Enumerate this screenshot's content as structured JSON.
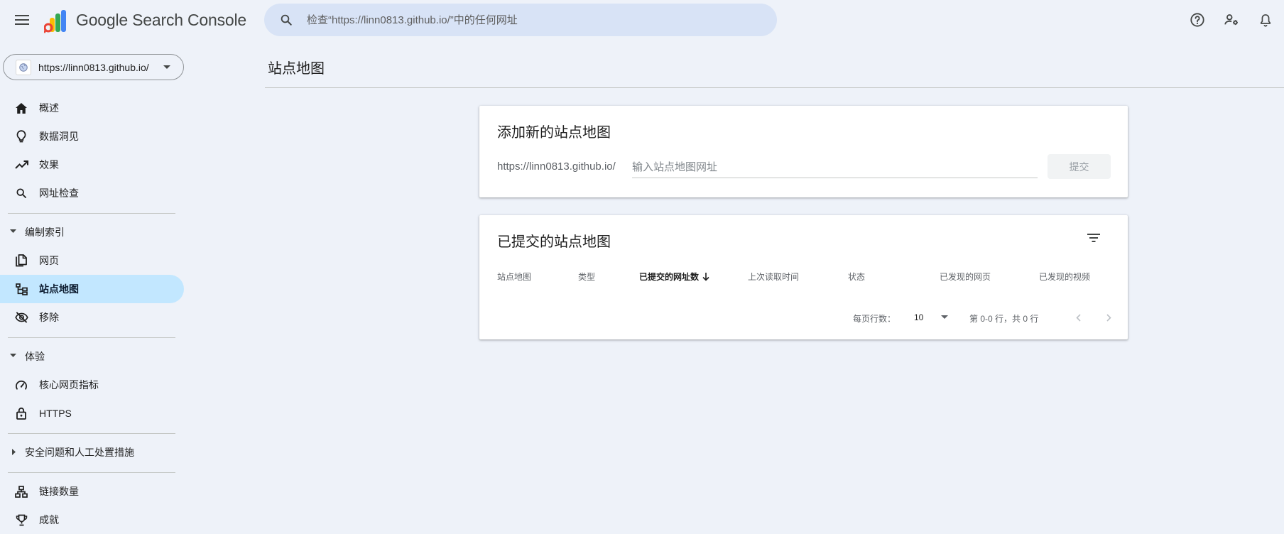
{
  "header": {
    "product_name": "Google Search Console",
    "search_placeholder": "检查“https://linn0813.github.io/”中的任何网址",
    "icons": [
      "menu-icon",
      "search-icon",
      "help-icon",
      "manage-users-icon",
      "notifications-icon"
    ]
  },
  "sidebar": {
    "property": "https://linn0813.github.io/",
    "items": [
      {
        "label": "概述",
        "icon": "home-icon"
      },
      {
        "label": "数据洞见",
        "icon": "lightbulb-icon"
      },
      {
        "label": "效果",
        "icon": "trending-up-icon"
      },
      {
        "label": "网址检查",
        "icon": "search-icon"
      }
    ],
    "section_indexing": "编制索引",
    "indexing_items": [
      {
        "label": "网页",
        "icon": "pages-icon"
      },
      {
        "label": "站点地图",
        "icon": "sitemap-icon",
        "active": true
      },
      {
        "label": "移除",
        "icon": "visibility-off-icon"
      }
    ],
    "section_experience": "体验",
    "experience_items": [
      {
        "label": "核心网页指标",
        "icon": "speed-icon"
      },
      {
        "label": "HTTPS",
        "icon": "lock-icon"
      }
    ],
    "section_security": "安全问题和人工处置措施",
    "bottom_items": [
      {
        "label": "链接数量",
        "icon": "links-icon"
      },
      {
        "label": "成就",
        "icon": "trophy-icon"
      }
    ]
  },
  "main": {
    "page_title": "站点地图",
    "add_card": {
      "title": "添加新的站点地图",
      "url_prefix": "https://linn0813.github.io/",
      "input_placeholder": "输入站点地图网址",
      "submit_label": "提交"
    },
    "list_card": {
      "title": "已提交的站点地图",
      "columns": [
        "站点地图",
        "类型",
        "已提交的网址数",
        "上次读取时间",
        "状态",
        "已发现的网页",
        "已发现的视频"
      ],
      "sorted_column": "已提交的网址数",
      "rows": [],
      "rows_per_page_label": "每页行数：",
      "rows_per_page": "10",
      "range_label": "第 0-0 行，共 0 行"
    }
  },
  "colors": {
    "background": "#eef2f9",
    "search_bg": "#d8e3f6",
    "active_nav": "#c2e7ff",
    "card_bg": "#ffffff"
  }
}
